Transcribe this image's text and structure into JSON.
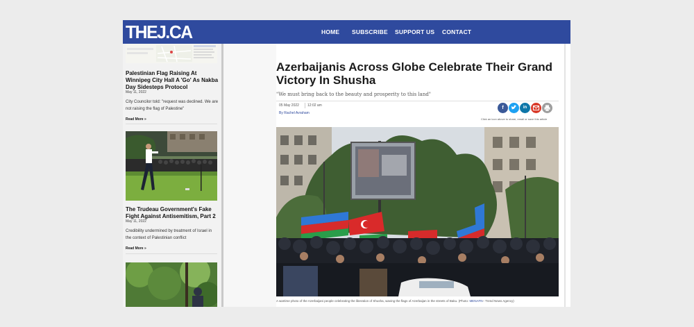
{
  "header": {
    "logo": "THEJ.CA",
    "nav": [
      "HOME",
      "SUBSCRIBE",
      "SUPPORT US",
      "CONTACT"
    ]
  },
  "sidebar": {
    "posts": [
      {
        "title": "Palestinian Flag Raising At Winnipeg City Hall A 'Go' As Nakba Day Sidesteps Protocol",
        "date": "May 11, 2022",
        "excerpt": "City Councilor told: \"request was declined. We are not raising the flag of Palestine\"",
        "read_more": "Read More »"
      },
      {
        "title": "The Trudeau Government's Fake Fight Against Antisemitism, Part 2",
        "date": "May 11, 2022",
        "excerpt": "Credibility undermined by treatment of Israel in the context of Palestinian conflict",
        "read_more": "Read More »"
      }
    ]
  },
  "article": {
    "headline": "Azerbaijanis Across Globe Celebrate Their Grand Victory In Shusha",
    "subhead": "\"We must bring back to the beauty and prosperity to this land\"",
    "date": "05 May 2022",
    "time": "12:02 am",
    "author": "By Rachel Avraham",
    "share_note": "Click an icon above to share, email or save this article",
    "share_icons": [
      "facebook-icon",
      "twitter-icon",
      "linkedin-icon",
      "email-icon",
      "print-icon"
    ],
    "caption_main": "A wartime photo of the Azerbaijani people celebrating the liberation of Shusha, waving the flags of Azerbaijan in the streets of Baku. (Photo: ",
    "caption_credit": "MENAFN",
    "caption_tail": "– Trend News Agency)"
  },
  "colors": {
    "brand": "#2f4a9e",
    "facebook": "#3b5998",
    "twitter": "#1da1f2",
    "linkedin": "#0e76a8",
    "email": "#d93b2b",
    "print": "#9e9e9e"
  }
}
